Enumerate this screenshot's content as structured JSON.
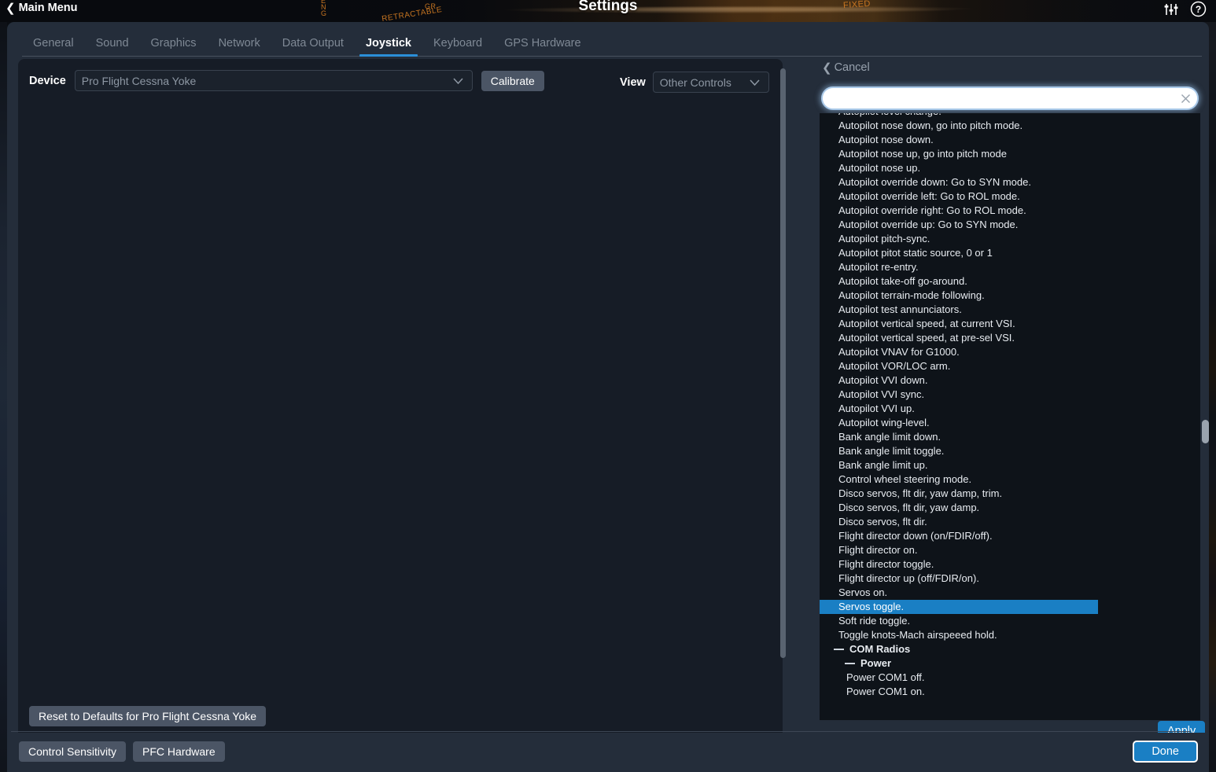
{
  "topbar": {
    "back_label": "Main Menu",
    "back_icon": "chevron-left-icon",
    "title": "Settings",
    "sliders_icon": "sliders-icon",
    "help_icon": "help-circle-icon",
    "photo_text": [
      "RETRACTABLE",
      "FIXED",
      "E",
      "N",
      "G",
      "GR"
    ]
  },
  "tabs": [
    {
      "label": "General",
      "active": false
    },
    {
      "label": "Sound",
      "active": false
    },
    {
      "label": "Graphics",
      "active": false
    },
    {
      "label": "Network",
      "active": false
    },
    {
      "label": "Data Output",
      "active": false
    },
    {
      "label": "Joystick",
      "active": true
    },
    {
      "label": "Keyboard",
      "active": false
    },
    {
      "label": "GPS Hardware",
      "active": false
    }
  ],
  "device": {
    "label": "Device",
    "value": "Pro Flight Cessna Yoke",
    "calibrate_label": "Calibrate"
  },
  "view": {
    "label": "View",
    "value": "Other Controls"
  },
  "reset_label": "Reset to Defaults for Pro Flight Cessna Yoke",
  "picker": {
    "cancel_label": "Cancel",
    "search_value": "",
    "search_placeholder": "",
    "clear_icon": "close-x-icon",
    "apply_label": "Apply",
    "selected_item": "Servos toggle.",
    "accent_color": "#1a7fc4",
    "items": [
      {
        "text": "Autopilot level change.",
        "type": "item",
        "clipped": true
      },
      {
        "text": "Autopilot nose down, go into pitch mode.",
        "type": "item"
      },
      {
        "text": "Autopilot nose down.",
        "type": "item"
      },
      {
        "text": "Autopilot nose up, go into pitch mode",
        "type": "item"
      },
      {
        "text": "Autopilot nose up.",
        "type": "item"
      },
      {
        "text": "Autopilot override down: Go to SYN mode.",
        "type": "item"
      },
      {
        "text": "Autopilot override left: Go to ROL mode.",
        "type": "item"
      },
      {
        "text": "Autopilot override right: Go to ROL mode.",
        "type": "item"
      },
      {
        "text": "Autopilot override up: Go to SYN mode.",
        "type": "item"
      },
      {
        "text": "Autopilot pitch-sync.",
        "type": "item"
      },
      {
        "text": "Autopilot pitot static source, 0 or 1",
        "type": "item"
      },
      {
        "text": "Autopilot re-entry.",
        "type": "item"
      },
      {
        "text": "Autopilot take-off go-around.",
        "type": "item"
      },
      {
        "text": "Autopilot terrain-mode following.",
        "type": "item"
      },
      {
        "text": "Autopilot test annunciators.",
        "type": "item"
      },
      {
        "text": "Autopilot vertical speed, at current VSI.",
        "type": "item"
      },
      {
        "text": "Autopilot vertical speed, at pre-sel VSI.",
        "type": "item"
      },
      {
        "text": "Autopilot VNAV for G1000.",
        "type": "item"
      },
      {
        "text": "Autopilot VOR/LOC arm.",
        "type": "item"
      },
      {
        "text": "Autopilot VVI down.",
        "type": "item"
      },
      {
        "text": "Autopilot VVI sync.",
        "type": "item"
      },
      {
        "text": "Autopilot VVI up.",
        "type": "item"
      },
      {
        "text": "Autopilot wing-level.",
        "type": "item"
      },
      {
        "text": "Bank angle limit down.",
        "type": "item"
      },
      {
        "text": "Bank angle limit toggle.",
        "type": "item"
      },
      {
        "text": "Bank angle limit up.",
        "type": "item"
      },
      {
        "text": "Control wheel steering mode.",
        "type": "item"
      },
      {
        "text": "Disco servos, flt dir, yaw damp, trim.",
        "type": "item"
      },
      {
        "text": "Disco servos, flt dir, yaw damp.",
        "type": "item"
      },
      {
        "text": "Disco servos, flt dir.",
        "type": "item"
      },
      {
        "text": "Flight director down (on/FDIR/off).",
        "type": "item"
      },
      {
        "text": "Flight director on.",
        "type": "item"
      },
      {
        "text": "Flight director toggle.",
        "type": "item"
      },
      {
        "text": "Flight director up (off/FDIR/on).",
        "type": "item"
      },
      {
        "text": "Servos on.",
        "type": "item"
      },
      {
        "text": "Servos toggle.",
        "type": "item",
        "selected": true
      },
      {
        "text": "Soft ride toggle.",
        "type": "item"
      },
      {
        "text": "Toggle knots-Mach airspeeed hold.",
        "type": "item"
      },
      {
        "text": "COM Radios",
        "type": "group"
      },
      {
        "text": "Power",
        "type": "group2"
      },
      {
        "text": "Power COM1 off.",
        "type": "child"
      },
      {
        "text": "Power COM1 on.",
        "type": "child",
        "clipped": true
      }
    ]
  },
  "bottom": {
    "control_sensitivity_label": "Control Sensitivity",
    "pfc_hardware_label": "PFC Hardware",
    "done_label": "Done"
  }
}
